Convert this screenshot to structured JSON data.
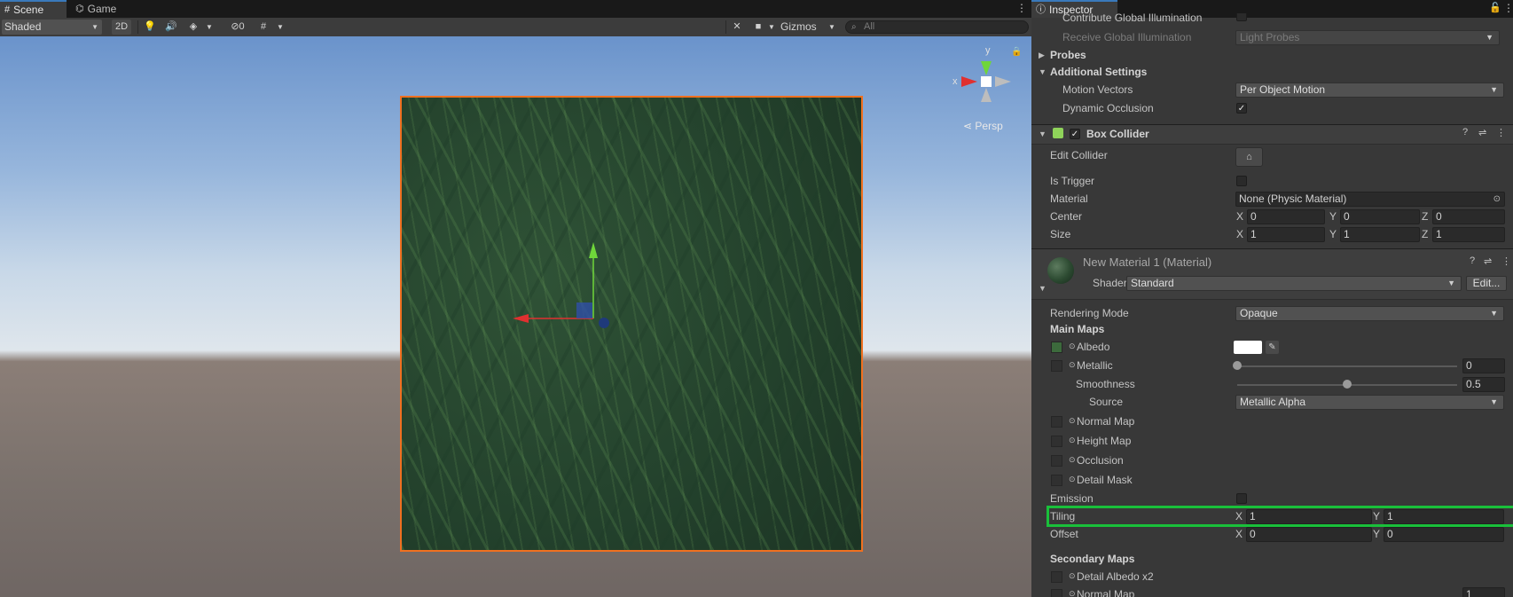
{
  "scene": {
    "tabs": [
      {
        "label": "Scene",
        "icon": "hash-grid-icon"
      },
      {
        "label": "Game",
        "icon": "gamepad-icon"
      }
    ],
    "toolbar": {
      "shading_mode": "Shaded",
      "twod_label": "2D",
      "hidden_count": "0",
      "gizmos_label": "Gizmos",
      "search_placeholder": "All"
    },
    "gizmo": {
      "y_label": "y",
      "x_label": "x",
      "persp_label": "Persp"
    }
  },
  "inspector": {
    "tab_label": "Inspector",
    "rows": {
      "contribute_gi": "Contribute Global Illumination",
      "receive_gi": "Receive Global Illumination",
      "receive_gi_value": "Light Probes",
      "probes": "Probes",
      "additional_settings": "Additional Settings",
      "motion_vectors": "Motion Vectors",
      "motion_vectors_value": "Per Object Motion",
      "dynamic_occlusion": "Dynamic Occlusion"
    },
    "box_collider": {
      "title": "Box Collider",
      "edit_collider": "Edit Collider",
      "is_trigger": "Is Trigger",
      "material": "Material",
      "material_value": "None (Physic Material)",
      "center": "Center",
      "center_x": "0",
      "center_y": "0",
      "center_z": "0",
      "size": "Size",
      "size_x": "1",
      "size_y": "1",
      "size_z": "1"
    },
    "material": {
      "title": "New Material 1 (Material)",
      "shader_label": "Shader",
      "shader_value": "Standard",
      "edit_button": "Edit...",
      "rendering_mode": "Rendering Mode",
      "rendering_mode_value": "Opaque",
      "main_maps": "Main Maps",
      "albedo": "Albedo",
      "metallic": "Metallic",
      "metallic_value": "0",
      "metallic_level": 0,
      "smoothness": "Smoothness",
      "smoothness_value": "0.5",
      "smoothness_level": 0.5,
      "source": "Source",
      "source_value": "Metallic Alpha",
      "normal_map": "Normal Map",
      "height_map": "Height Map",
      "occlusion": "Occlusion",
      "detail_mask": "Detail Mask",
      "emission": "Emission",
      "tiling": "Tiling",
      "tiling_x": "1",
      "tiling_y": "1",
      "offset": "Offset",
      "offset_x": "0",
      "offset_y": "0",
      "secondary_maps": "Secondary Maps",
      "detail_albedo": "Detail Albedo x2",
      "normal_map_2": "Normal Map",
      "normal_map_2_value": "1"
    },
    "axes": {
      "x": "X",
      "y": "Y",
      "z": "Z"
    }
  },
  "colors": {
    "selection_outline": "#f07020",
    "highlight_box": "#19c03a",
    "gizmo_x": "#e03030",
    "gizmo_y": "#6fd63a",
    "gizmo_z": "#2f4fa8"
  }
}
